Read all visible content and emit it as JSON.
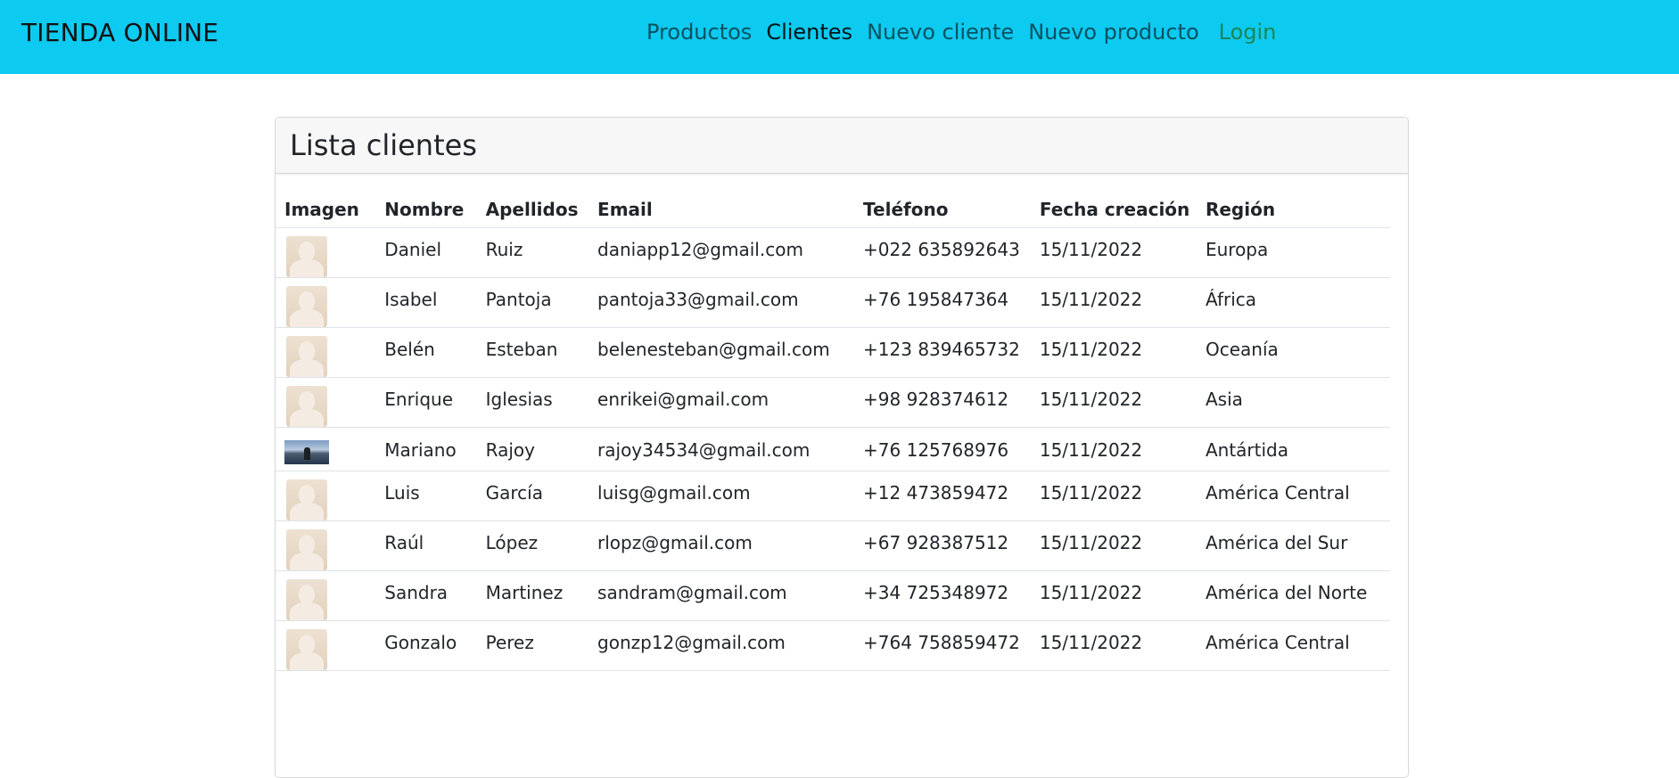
{
  "navbar": {
    "brand": "TIENDA ONLINE",
    "links": [
      {
        "label": "Productos",
        "state": "normal"
      },
      {
        "label": "Clientes",
        "state": "active"
      },
      {
        "label": "Nuevo cliente",
        "state": "normal"
      },
      {
        "label": "Nuevo producto",
        "state": "normal"
      },
      {
        "label": "Login",
        "state": "login"
      }
    ],
    "colors": {
      "background": "#0dcaf0",
      "login": "#198754"
    }
  },
  "card": {
    "title": "Lista clientes"
  },
  "table": {
    "headers": [
      "Imagen",
      "Nombre",
      "Apellidos",
      "Email",
      "Teléfono",
      "Fecha creación",
      "Región"
    ],
    "rows": [
      {
        "image": "avatar-icon",
        "nombre": "Daniel",
        "apellidos": "Ruiz",
        "email": "daniapp12@gmail.com",
        "telefono": "+022 635892643",
        "fecha": "15/11/2022",
        "region": "Europa"
      },
      {
        "image": "avatar-icon",
        "nombre": "Isabel",
        "apellidos": "Pantoja",
        "email": "pantoja33@gmail.com",
        "telefono": "+76 195847364",
        "fecha": "15/11/2022",
        "region": "África"
      },
      {
        "image": "avatar-icon",
        "nombre": "Belén",
        "apellidos": "Esteban",
        "email": "belenesteban@gmail.com",
        "telefono": "+123 839465732",
        "fecha": "15/11/2022",
        "region": "Oceanía"
      },
      {
        "image": "avatar-icon",
        "nombre": "Enrique",
        "apellidos": "Iglesias",
        "email": "enrikei@gmail.com",
        "telefono": "+98 928374612",
        "fecha": "15/11/2022",
        "region": "Asia"
      },
      {
        "image": "photo",
        "nombre": "Mariano",
        "apellidos": "Rajoy",
        "email": "rajoy34534@gmail.com",
        "telefono": "+76 125768976",
        "fecha": "15/11/2022",
        "region": "Antártida"
      },
      {
        "image": "avatar-icon",
        "nombre": "Luis",
        "apellidos": "García",
        "email": "luisg@gmail.com",
        "telefono": "+12 473859472",
        "fecha": "15/11/2022",
        "region": "América Central"
      },
      {
        "image": "avatar-icon",
        "nombre": "Raúl",
        "apellidos": "López",
        "email": "rlopz@gmail.com",
        "telefono": "+67 928387512",
        "fecha": "15/11/2022",
        "region": "América del Sur"
      },
      {
        "image": "avatar-icon",
        "nombre": "Sandra",
        "apellidos": "Martinez",
        "email": "sandram@gmail.com",
        "telefono": "+34 725348972",
        "fecha": "15/11/2022",
        "region": "América del Norte"
      },
      {
        "image": "avatar-icon",
        "nombre": "Gonzalo",
        "apellidos": "Perez",
        "email": "gonzp12@gmail.com",
        "telefono": "+764 758859472",
        "fecha": "15/11/2022",
        "region": "América Central"
      }
    ]
  }
}
